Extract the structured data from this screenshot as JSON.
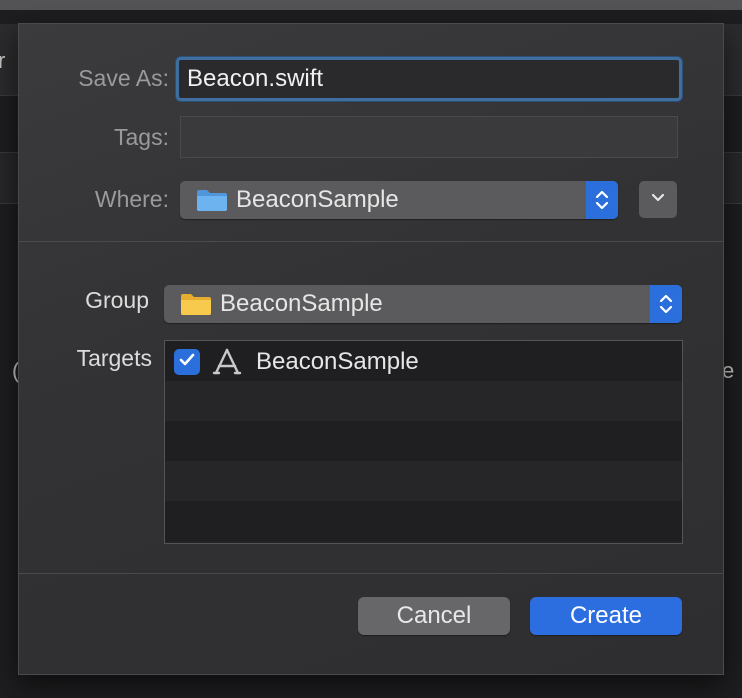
{
  "background": {
    "fragment_left_top": "r",
    "fragment_left_mid": "(",
    "fragment_right_mid": "e"
  },
  "dialog": {
    "save_as_label": "Save As:",
    "save_as_value": "Beacon.swift",
    "tags_label": "Tags:",
    "tags_value": "",
    "where_label": "Where:",
    "where_value": "BeaconSample",
    "group_label": "Group",
    "group_value": "BeaconSample",
    "targets_label": "Targets",
    "targets": [
      {
        "name": "BeaconSample",
        "checked": true
      }
    ],
    "cancel_label": "Cancel",
    "create_label": "Create"
  },
  "colors": {
    "accent": "#2c6ee0",
    "folder_blue": "#5aa6e6",
    "folder_yellow": "#f5c542",
    "sheet_bg": "#333335"
  },
  "icons": {
    "where_folder": "folder-blue-icon",
    "group_folder": "folder-yellow-icon",
    "target_app": "app-target-icon",
    "expand": "chevron-down-icon",
    "stepper": "up-down-chevron-icon",
    "check": "checkmark-icon"
  }
}
